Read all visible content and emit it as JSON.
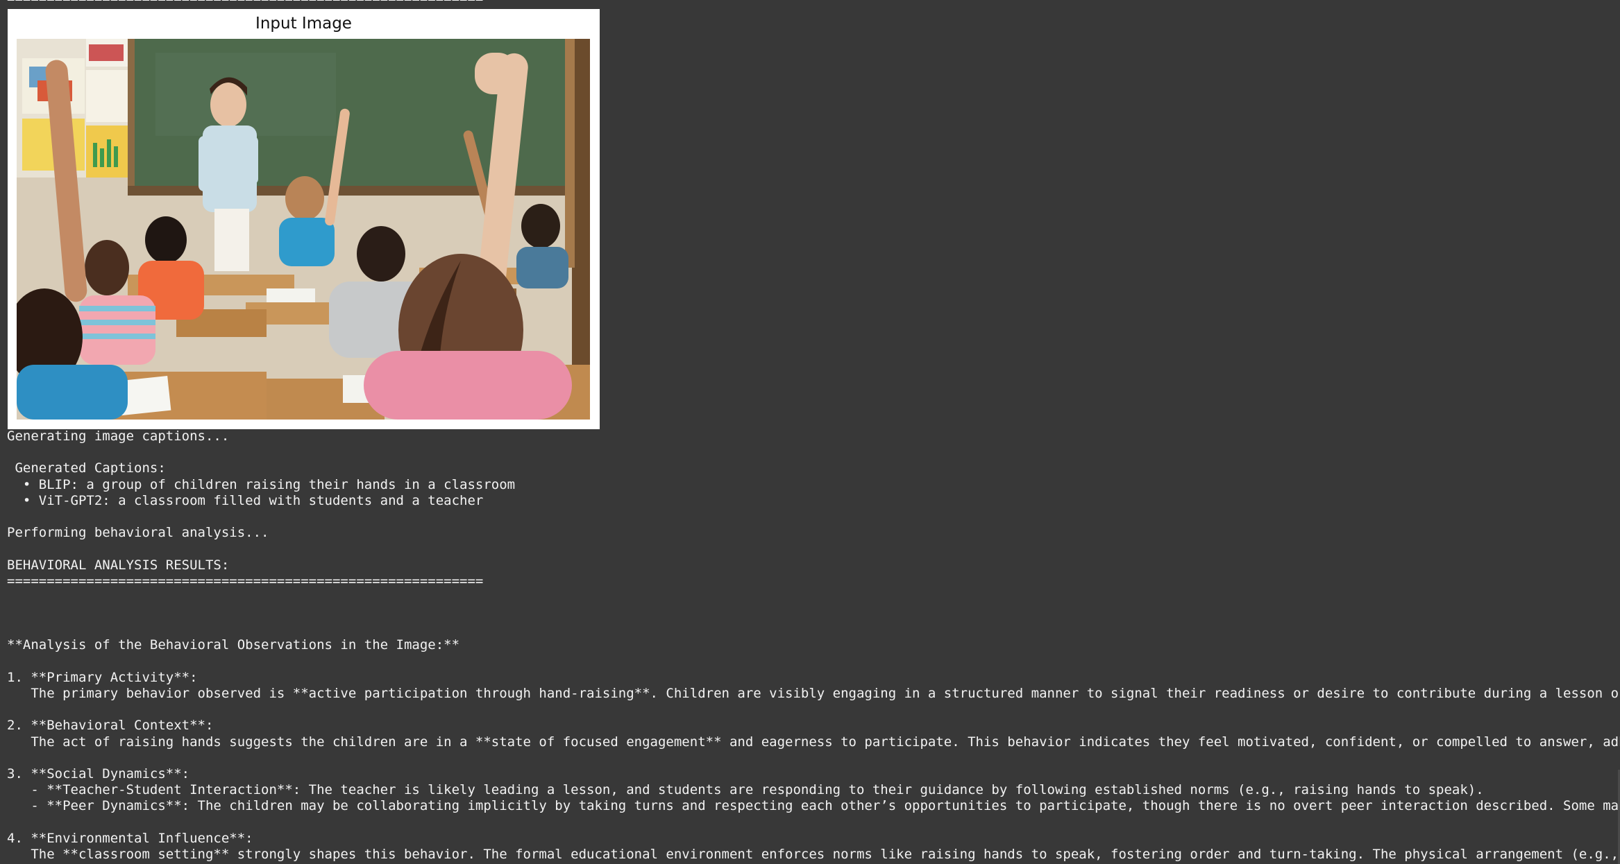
{
  "rule": "============================================================",
  "figure": {
    "title": "Input Image",
    "image_alt": "Classroom photo: teacher standing at a green chalkboard while children at desks raise their hands"
  },
  "log_lines": [
    "Generating image captions...",
    "",
    " Generated Captions:",
    "  • BLIP: a group of children raising their hands in a classroom",
    "  • ViT-GPT2: a classroom filled with students and a teacher",
    "",
    "Performing behavioral analysis...",
    "",
    "BEHAVIORAL ANALYSIS RESULTS:",
    "============================================================",
    "",
    "",
    "",
    "**Analysis of the Behavioral Observations in the Image:**",
    "",
    "1. **Primary Activity**:",
    "   The primary behavior observed is **active participation through hand-raising**. Children are visibly engaging in a structured manner to signal their readiness or desire to contribute during a lesson or d",
    "",
    "2. **Behavioral Context**:",
    "   The act of raising hands suggests the children are in a **state of focused engagement** and eagerness to participate. This behavior indicates they feel motivated, confident, or compelled to answer, adher",
    "",
    "3. **Social Dynamics**:",
    "   - **Teacher-Student Interaction**: The teacher is likely leading a lesson, and students are responding to their guidance by following established norms (e.g., raising hands to speak).",
    "   - **Peer Dynamics**: The children may be collaborating implicitly by taking turns and respecting each other’s opportunities to participate, though there is no overt peer interaction described. Some may e",
    "",
    "4. **Environmental Influence**:",
    "   The **classroom setting** strongly shapes this behavior. The formal educational environment enforces norms like raising hands to speak, fostering order and turn-taking. The physical arrangement (e.g., de"
  ]
}
